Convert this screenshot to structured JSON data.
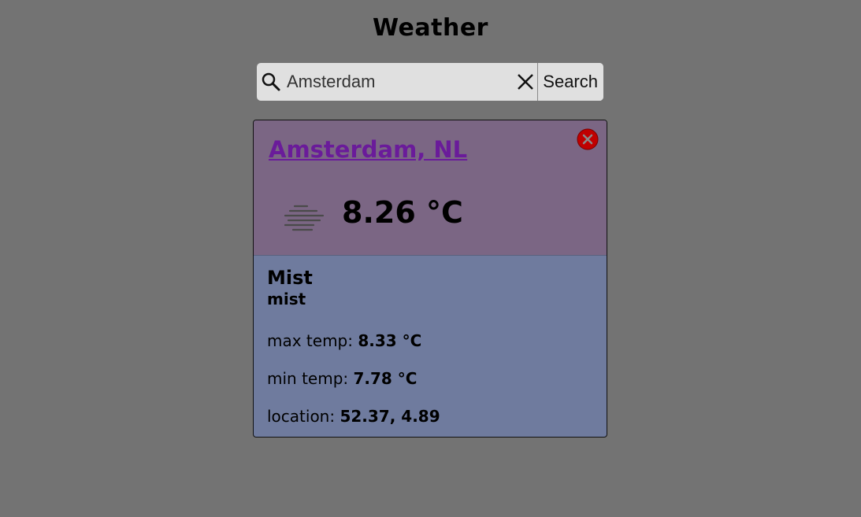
{
  "header": {
    "title": "Weather"
  },
  "search": {
    "value": "Amsterdam",
    "button_label": "Search"
  },
  "card": {
    "city": "Amsterdam, NL",
    "temperature": "8.26 °C",
    "icon": "mist-icon",
    "condition": "Mist",
    "description": "mist",
    "details": [
      {
        "label": "max temp: ",
        "value": "8.33 °C"
      },
      {
        "label": "min temp: ",
        "value": "7.78 °C"
      },
      {
        "label": "location: ",
        "value": "52.37, 4.89"
      }
    ]
  },
  "colors": {
    "background": "#737373",
    "card_top": "#7b6684",
    "card_bottom": "#6f7b9e",
    "link": "#6a1b9a",
    "close_button": "#c00000"
  }
}
